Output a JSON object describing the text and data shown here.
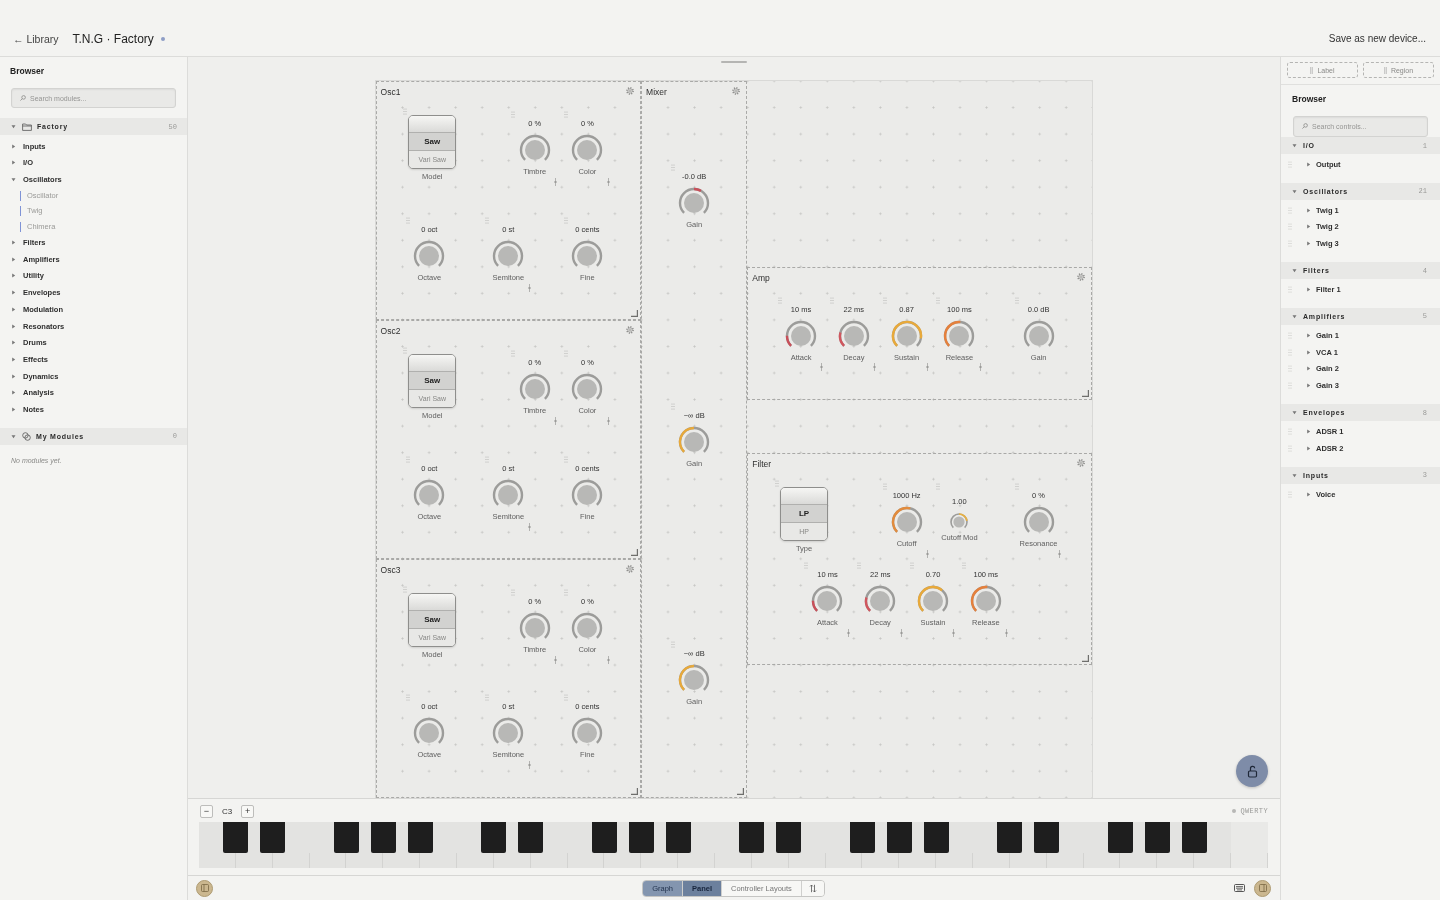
{
  "header": {
    "back_link": "← Library",
    "title": "T.N.G · Factory",
    "unsaved": true,
    "save_button": "Save as new device..."
  },
  "left_sidebar": {
    "title": "Browser",
    "search": {
      "placeholder": "Search modules..."
    },
    "groups": [
      {
        "kind": "factory",
        "name": "Factory",
        "count": "50",
        "expanded": true,
        "items": [
          {
            "label": "Inputs",
            "expanded": false
          },
          {
            "label": "I/O",
            "expanded": false
          },
          {
            "label": "Oscillators",
            "expanded": true,
            "children": [
              {
                "label": "Oscillator"
              },
              {
                "label": "Twig"
              },
              {
                "label": "Chimera"
              }
            ]
          },
          {
            "label": "Filters",
            "expanded": false
          },
          {
            "label": "Amplifiers",
            "expanded": false
          },
          {
            "label": "Utility",
            "expanded": false
          },
          {
            "label": "Envelopes",
            "expanded": false
          },
          {
            "label": "Modulation",
            "expanded": false
          },
          {
            "label": "Resonators",
            "expanded": false
          },
          {
            "label": "Drums",
            "expanded": false
          },
          {
            "label": "Effects",
            "expanded": false
          },
          {
            "label": "Dynamics",
            "expanded": false
          },
          {
            "label": "Analysis",
            "expanded": false
          },
          {
            "label": "Notes",
            "expanded": false
          }
        ]
      },
      {
        "kind": "user",
        "name": "My Modules",
        "count": "0",
        "expanded": true,
        "empty_text": "No modules yet."
      }
    ]
  },
  "panel": {
    "modules": [
      {
        "kind": "oscillator",
        "title": "Osc1",
        "controls": [
          {
            "kind": "selector",
            "title": "Model",
            "resize_handle": false,
            "options": [
              {
                "label": "Saw",
                "selected": true
              },
              {
                "label": "Vari Saw",
                "selected": false
              }
            ]
          },
          {
            "kind": "knob",
            "label": "Timbre",
            "value": "0 %",
            "resize_handle": true
          },
          {
            "kind": "knob",
            "label": "Color",
            "value": "0 %",
            "resize_handle": true
          },
          {
            "kind": "knob",
            "label": "Octave",
            "value": "0 oct",
            "resize_handle": false
          },
          {
            "kind": "knob",
            "label": "Semitone",
            "value": "0 st",
            "resize_handle": true
          },
          {
            "kind": "knob",
            "label": "Fine",
            "value": "0 cents",
            "resize_handle": false
          }
        ]
      },
      {
        "kind": "oscillator",
        "title": "Osc2",
        "controls": [
          {
            "kind": "selector",
            "title": "Model",
            "resize_handle": false,
            "options": [
              {
                "label": "Saw",
                "selected": true
              },
              {
                "label": "Vari Saw",
                "selected": false
              }
            ]
          },
          {
            "kind": "knob",
            "label": "Timbre",
            "value": "0 %",
            "resize_handle": true
          },
          {
            "kind": "knob",
            "label": "Color",
            "value": "0 %",
            "resize_handle": true
          },
          {
            "kind": "knob",
            "label": "Octave",
            "value": "0 oct",
            "resize_handle": false
          },
          {
            "kind": "knob",
            "label": "Semitone",
            "value": "0 st",
            "resize_handle": true
          },
          {
            "kind": "knob",
            "label": "Fine",
            "value": "0 cents",
            "resize_handle": false
          }
        ]
      },
      {
        "kind": "oscillator",
        "title": "Osc3",
        "controls": [
          {
            "kind": "selector",
            "title": "Model",
            "resize_handle": false,
            "options": [
              {
                "label": "Saw",
                "selected": true
              },
              {
                "label": "Vari Saw",
                "selected": false
              }
            ]
          },
          {
            "kind": "knob",
            "label": "Timbre",
            "value": "0 %",
            "resize_handle": true
          },
          {
            "kind": "knob",
            "label": "Color",
            "value": "0 %",
            "resize_handle": true
          },
          {
            "kind": "knob",
            "label": "Octave",
            "value": "0 oct",
            "resize_handle": false
          },
          {
            "kind": "knob",
            "label": "Semitone",
            "value": "0 st",
            "resize_handle": true
          },
          {
            "kind": "knob",
            "label": "Fine",
            "value": "0 cents",
            "resize_handle": false
          }
        ]
      },
      {
        "kind": "mixer",
        "title": "Mixer",
        "controls": [
          {
            "kind": "knob",
            "label": "Gain",
            "value": "-0.0 dB",
            "level": 0.61,
            "bipolar": true,
            "color": "#c8505a",
            "resize_handle": false
          },
          {
            "kind": "knob",
            "label": "Gain",
            "value": "−∞ dB",
            "level": 0.5,
            "bipolar": false,
            "color": "#e8a93a",
            "resize_handle": false
          },
          {
            "kind": "knob",
            "label": "Gain",
            "value": "−∞ dB",
            "level": 0.5,
            "bipolar": false,
            "color": "#e8a93a",
            "resize_handle": false
          }
        ]
      },
      {
        "kind": "amp",
        "title": "Amp",
        "controls": [
          {
            "kind": "knob",
            "label": "Attack",
            "value": "10 ms",
            "level": 0.17,
            "bipolar": false,
            "color": "#c8505a",
            "resize_handle": true
          },
          {
            "kind": "knob",
            "label": "Decay",
            "value": "22 ms",
            "level": 0.22,
            "bipolar": false,
            "color": "#d0565e",
            "resize_handle": true
          },
          {
            "kind": "knob",
            "label": "Sustain",
            "value": "0.87",
            "level": 0.87,
            "bipolar": false,
            "color": "#e8a93a",
            "resize_handle": true
          },
          {
            "kind": "knob",
            "label": "Release",
            "value": "100 ms",
            "level": 0.52,
            "bipolar": false,
            "color": "#e5803c",
            "resize_handle": true
          },
          {
            "kind": "knob",
            "label": "Gain",
            "value": "0.0 dB",
            "resize_handle": false
          }
        ]
      },
      {
        "kind": "filter",
        "title": "Filter",
        "controls": [
          {
            "kind": "selector",
            "title": "Type",
            "resize_handle": false,
            "options": [
              {
                "label": "LP",
                "selected": true
              },
              {
                "label": "HP",
                "selected": false
              }
            ]
          },
          {
            "kind": "knob",
            "label": "Cutoff",
            "value": "1000 Hz",
            "level": 0.55,
            "bipolar": false,
            "color": "#e28b3c",
            "resize_handle": true
          },
          {
            "kind": "small_knob",
            "label": "Cutoff Mod",
            "value": "1.00",
            "level": 0.8,
            "bipolar": true,
            "color": "#e8b040",
            "resize_handle": false
          },
          {
            "kind": "knob",
            "label": "Resonance",
            "value": "0 %",
            "resize_handle": true
          },
          {
            "kind": "knob",
            "label": "Attack",
            "value": "10 ms",
            "level": 0.17,
            "bipolar": false,
            "color": "#c8505a",
            "resize_handle": true
          },
          {
            "kind": "knob",
            "label": "Decay",
            "value": "22 ms",
            "level": 0.22,
            "bipolar": false,
            "color": "#d0565e",
            "resize_handle": true
          },
          {
            "kind": "knob",
            "label": "Sustain",
            "value": "0.70",
            "level": 0.65,
            "bipolar": false,
            "color": "#e8a93a",
            "resize_handle": true
          },
          {
            "kind": "knob",
            "label": "Release",
            "value": "100 ms",
            "level": 0.52,
            "bipolar": false,
            "color": "#e5803c",
            "resize_handle": true
          }
        ]
      }
    ]
  },
  "right_sidebar": {
    "tools": [
      {
        "label": "Label"
      },
      {
        "label": "Region"
      }
    ],
    "title": "Browser",
    "search": {
      "placeholder": "Search controls..."
    },
    "groups": [
      {
        "name": "I/O",
        "count": "1",
        "expanded": true,
        "items": [
          {
            "label": "Output",
            "expanded": false
          }
        ]
      },
      {
        "name": "Oscillators",
        "count": "21",
        "expanded": true,
        "items": [
          {
            "label": "Twig 1",
            "expanded": false
          },
          {
            "label": "Twig 2",
            "expanded": false
          },
          {
            "label": "Twig 3",
            "expanded": false
          }
        ]
      },
      {
        "name": "Filters",
        "count": "4",
        "expanded": true,
        "items": [
          {
            "label": "Filter 1",
            "expanded": false
          }
        ]
      },
      {
        "name": "Amplifiers",
        "count": "5",
        "expanded": true,
        "items": [
          {
            "label": "Gain 1",
            "expanded": false
          },
          {
            "label": "VCA 1",
            "expanded": false
          },
          {
            "label": "Gain 2",
            "expanded": false
          },
          {
            "label": "Gain 3",
            "expanded": false
          }
        ]
      },
      {
        "name": "Envelopes",
        "count": "8",
        "expanded": true,
        "items": [
          {
            "label": "ADSR 1",
            "expanded": false
          },
          {
            "label": "ADSR 2",
            "expanded": false
          }
        ]
      },
      {
        "name": "Inputs",
        "count": "3",
        "expanded": true,
        "items": [
          {
            "label": "Voice",
            "expanded": false
          }
        ]
      }
    ]
  },
  "keyboard": {
    "decrease": "−",
    "octave": "C3",
    "increase": "+",
    "input_mode": "QWERTY"
  },
  "bottom_bar": {
    "view_tabs": [
      {
        "label": "Graph",
        "kind": "view",
        "selected": false
      },
      {
        "label": "Panel",
        "kind": "view",
        "selected": true
      },
      {
        "label": "Controller Layouts",
        "kind": "layouts",
        "selected": false
      }
    ]
  }
}
